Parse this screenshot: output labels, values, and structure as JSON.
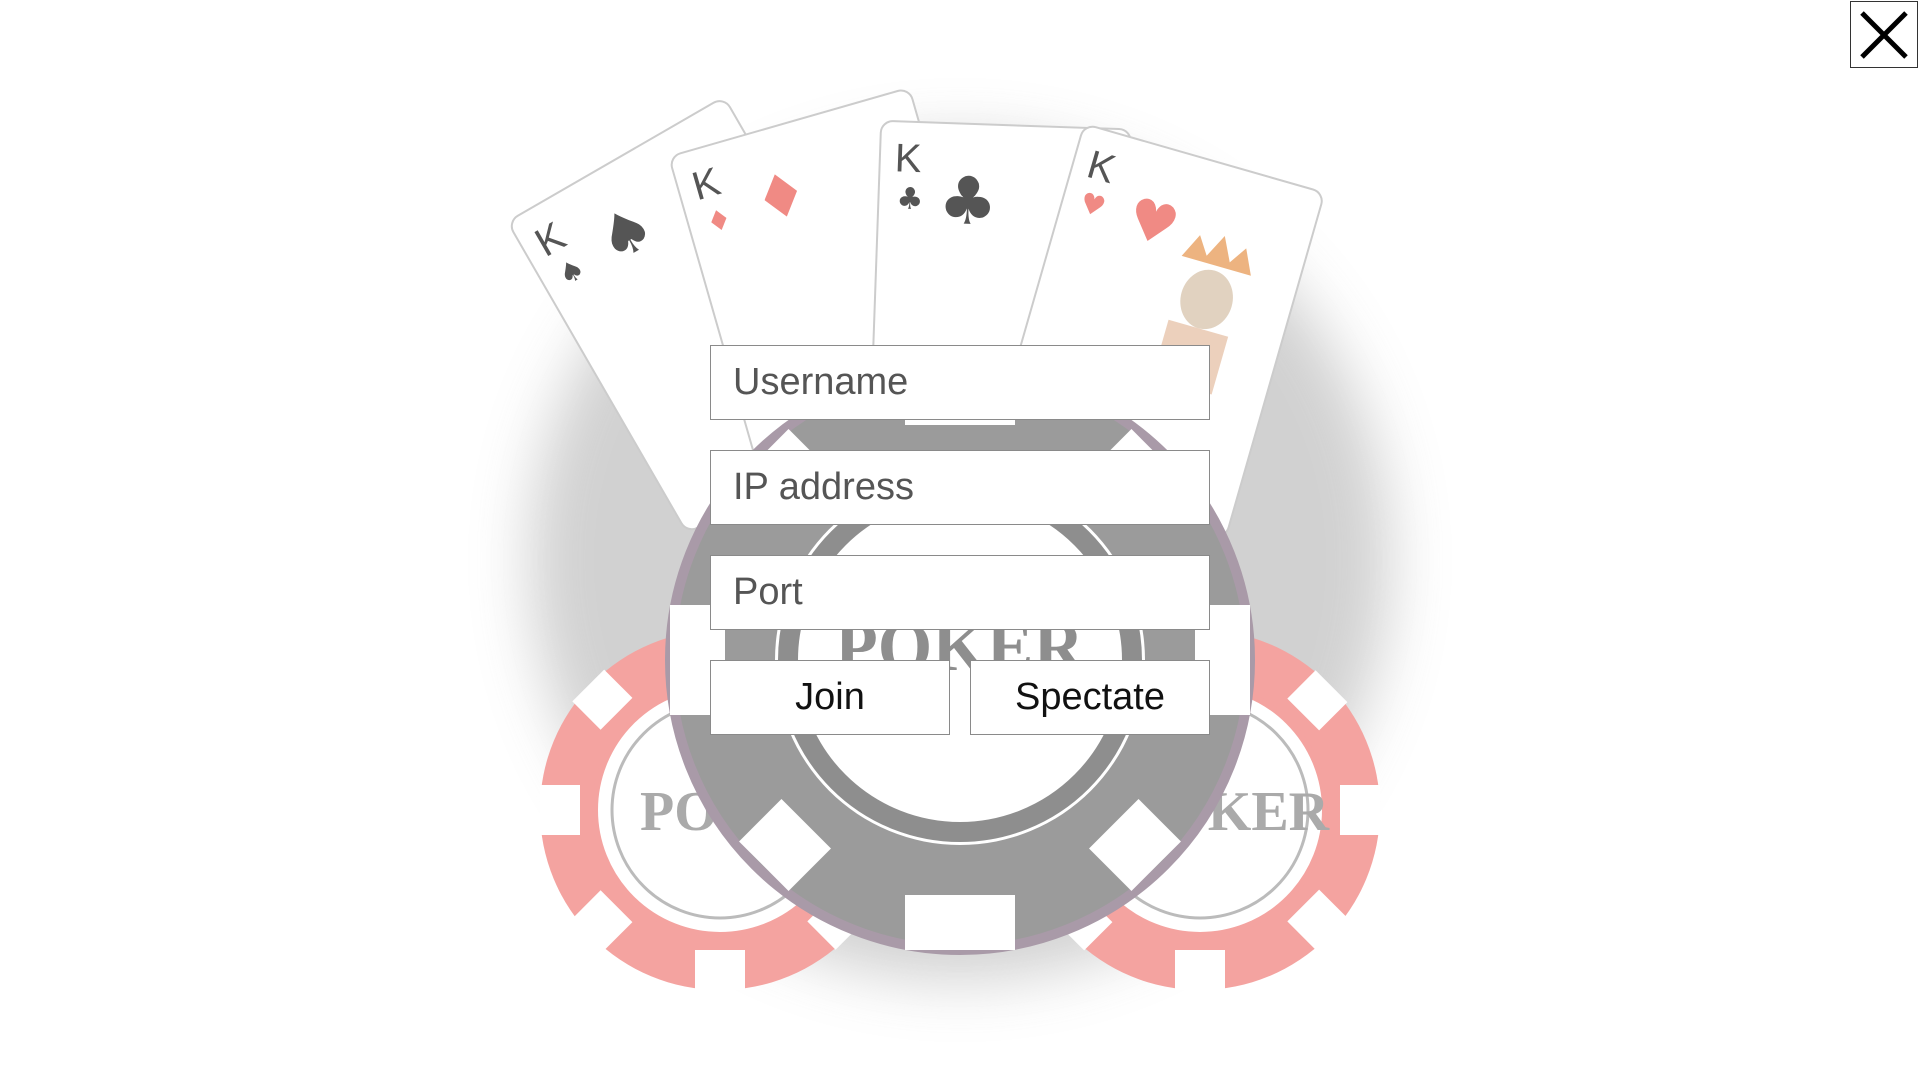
{
  "window": {
    "close_icon": "close-icon"
  },
  "form": {
    "username_placeholder": "Username",
    "ip_placeholder": "IP address",
    "port_placeholder": "Port",
    "join_label": "Join",
    "spectate_label": "Spectate"
  },
  "background": {
    "description_icons": [
      "king-of-spades-card",
      "king-of-diamonds-card",
      "king-of-clubs-card",
      "king-of-hearts-card",
      "poker-chip-icon"
    ],
    "chip_text": "POKER",
    "card_rank": "K",
    "colors": {
      "chip_red": "#f4a3a0",
      "chip_gray": "#8c8c8c",
      "card_red": "#f08a84",
      "card_dark": "#555555"
    }
  }
}
